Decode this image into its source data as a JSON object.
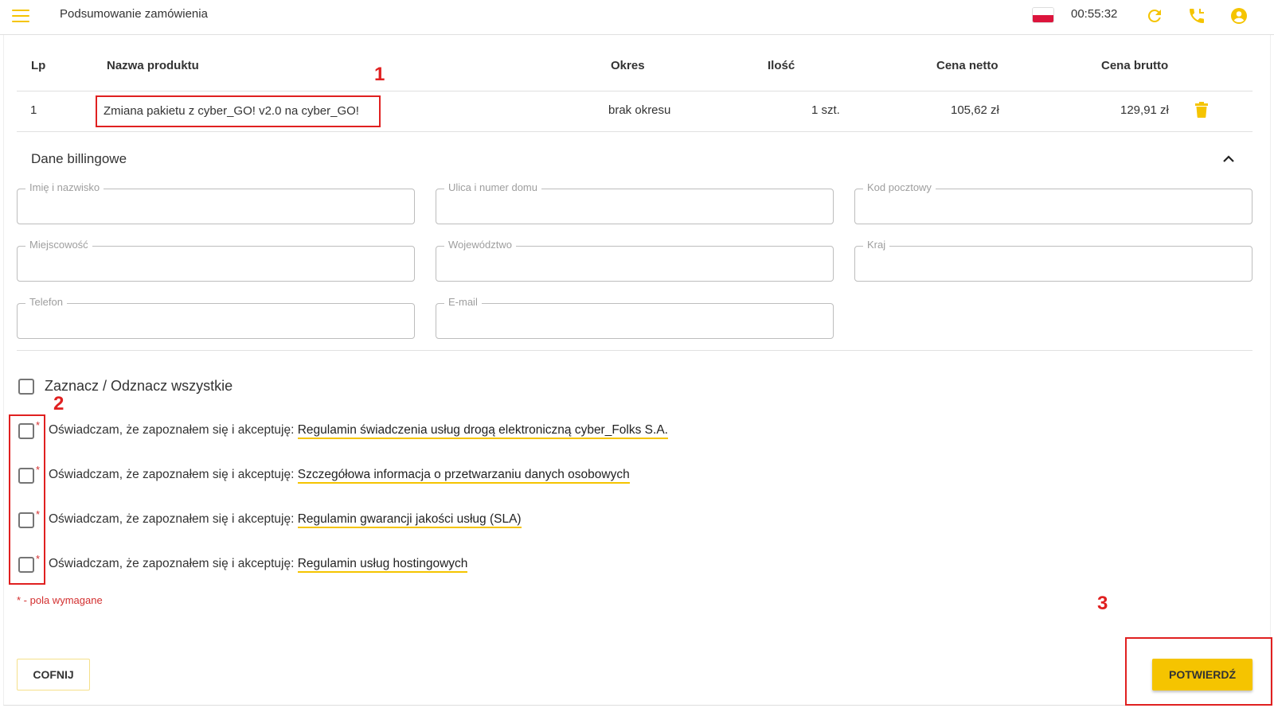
{
  "header": {
    "title": "Podsumowanie zamówienia",
    "clock": "00:55:32",
    "icons": [
      "menu-icon",
      "flag-pl-icon",
      "refresh-icon",
      "phone-icon",
      "account-icon"
    ]
  },
  "table": {
    "columns": [
      "Lp",
      "Nazwa produktu",
      "Okres",
      "Ilość",
      "Cena netto",
      "Cena brutto"
    ],
    "rows": [
      {
        "lp": "1",
        "name": "Zmiana pakietu z cyber_GO! v2.0 na cyber_GO!",
        "period": "brak okresu",
        "qty": "1 szt.",
        "net": "105,62 zł",
        "gross": "129,91 zł"
      }
    ]
  },
  "billing": {
    "title": "Dane billingowe",
    "fields": {
      "name": "Imię i nazwisko",
      "street": "Ulica i numer domu",
      "postcode": "Kod pocztowy",
      "city": "Miejscowość",
      "province": "Województwo",
      "country": "Kraj",
      "phone": "Telefon",
      "email": "E-mail"
    }
  },
  "consents": {
    "select_all": "Zaznacz / Odznacz wszystkie",
    "prefix": "Oświadczam, że zapoznałem się i akceptuję:",
    "star": "*",
    "items": [
      "Regulamin świadczenia usług drogą elektroniczną cyber_Folks S.A.",
      "Szczegółowa informacja o przetwarzaniu danych osobowych",
      "Regulamin gwarancji jakości usług (SLA)",
      "Regulamin usług hostingowych"
    ],
    "required_note": "* - pola wymagane"
  },
  "buttons": {
    "back": "COFNIJ",
    "confirm": "POTWIERDŹ"
  },
  "annotations": [
    "1",
    "2",
    "3"
  ],
  "colors": {
    "accent": "#f5c400",
    "annotation": "#e02020",
    "required": "#d32f2f"
  }
}
